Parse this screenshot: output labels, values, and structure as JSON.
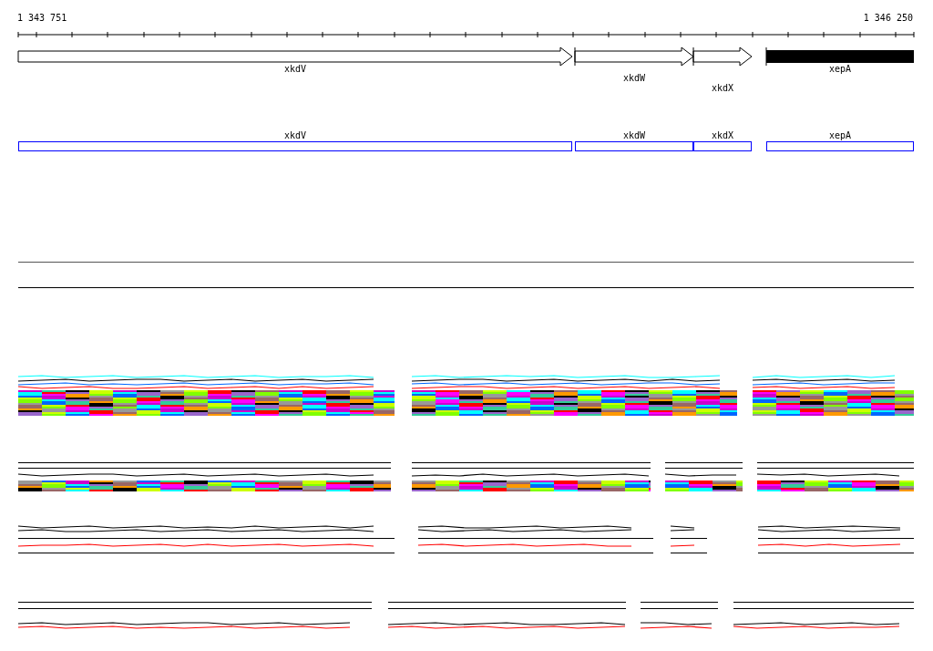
{
  "ruler": {
    "start_label": "1 343 751",
    "end_label": "1 346 250"
  },
  "genes": [
    {
      "label": "xkdV",
      "kind": "arrow"
    },
    {
      "label": "xkdW",
      "kind": "arrow"
    },
    {
      "label": "xkdX",
      "kind": "arrow"
    },
    {
      "label": "xepA",
      "kind": "block"
    }
  ],
  "features": [
    {
      "label": "xkdV"
    },
    {
      "label": "xkdW"
    },
    {
      "label": "xkdX"
    },
    {
      "label": "xepA"
    }
  ]
}
